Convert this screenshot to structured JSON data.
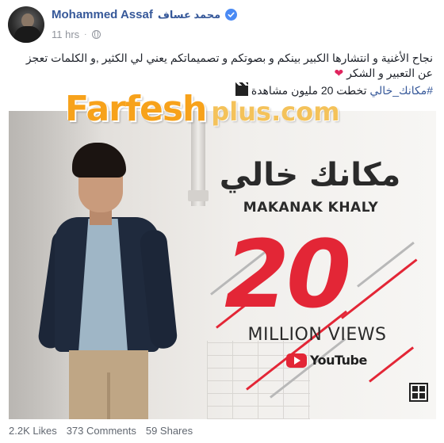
{
  "post": {
    "author": "Mohammed Assaf",
    "author_arabic": "محمد عساف",
    "time": "11 hrs",
    "text": "نجاح الأغنية و انتشارها الكبير بينكم و بصوتكم و تصميماتكم يعني لي الكثير ,و الكلمات تعجز عن التعبير و الشكر",
    "hashtag": "#مكانك_خالي",
    "hashtag_suffix": "تخطت 20 مليون مشاهدة",
    "icons": {
      "verified": "verified-badge-icon",
      "privacy": "globe-icon",
      "heart": "heart-icon",
      "clapper": "clapperboard-icon"
    }
  },
  "watermark": {
    "main": "Farfesh",
    "plus": "plus.com"
  },
  "image": {
    "title_arabic": "مكانك خالي",
    "title_english": "MAKANAK KHALY",
    "number": "20",
    "views_label": "MILLION VIEWS",
    "platform": "YouTube",
    "accent_color": "#e32636"
  },
  "footer": {
    "likes": "2.2K Likes",
    "comments": "373 Comments",
    "shares": "59 Shares"
  }
}
